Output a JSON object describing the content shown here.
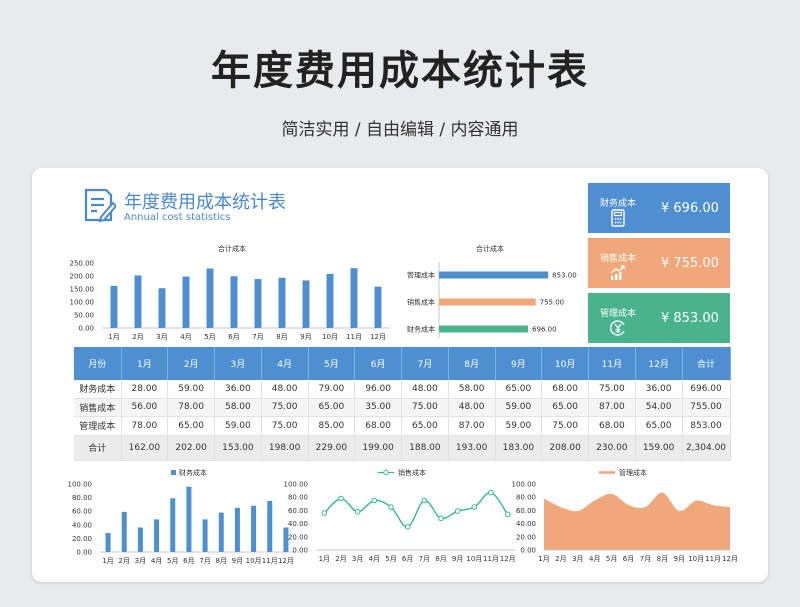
{
  "header": {
    "title": "年度费用成本统计表",
    "subtitle": "简洁实用 / 自由编辑 / 内容通用"
  },
  "card": {
    "title": "年度费用成本统计表",
    "subtitle": "Annual cost statistics"
  },
  "stats": [
    {
      "name": "财务成本",
      "value": "¥ 696.00",
      "color": "#4e8fd1",
      "icon": "calculator-icon"
    },
    {
      "name": "销售成本",
      "value": "¥ 755.00",
      "color": "#f0a779",
      "icon": "rising-chart-icon"
    },
    {
      "name": "管理成本",
      "value": "¥ 853.00",
      "color": "#49b48c",
      "icon": "yen-coin-icon"
    }
  ],
  "colors": {
    "blue": "#4e8fd1",
    "orange": "#f0a779",
    "green": "#49b48c",
    "line_green": "#3ab88e"
  },
  "table": {
    "headers": [
      "月份",
      "1月",
      "2月",
      "3月",
      "4月",
      "5月",
      "6月",
      "7月",
      "8月",
      "9月",
      "10月",
      "11月",
      "12月",
      "合计"
    ],
    "rows": [
      [
        "财务成本",
        "28.00",
        "59.00",
        "36.00",
        "48.00",
        "79.00",
        "96.00",
        "48.00",
        "58.00",
        "65.00",
        "68.00",
        "75.00",
        "36.00",
        "696.00"
      ],
      [
        "销售成本",
        "56.00",
        "78.00",
        "58.00",
        "75.00",
        "65.00",
        "35.00",
        "75.00",
        "48.00",
        "59.00",
        "65.00",
        "87.00",
        "54.00",
        "755.00"
      ],
      [
        "管理成本",
        "78.00",
        "65.00",
        "59.00",
        "75.00",
        "85.00",
        "68.00",
        "65.00",
        "87.00",
        "59.00",
        "75.00",
        "68.00",
        "65.00",
        "853.00"
      ],
      [
        "合计",
        "162.00",
        "202.00",
        "153.00",
        "198.00",
        "229.00",
        "199.00",
        "188.00",
        "193.00",
        "183.00",
        "208.00",
        "230.00",
        "159.00",
        "2,304.00"
      ]
    ]
  },
  "chart_data": [
    {
      "type": "bar",
      "title": "合计成本",
      "categories": [
        "1月",
        "2月",
        "3月",
        "4月",
        "5月",
        "6月",
        "7月",
        "8月",
        "9月",
        "10月",
        "11月",
        "12月"
      ],
      "values": [
        162,
        202,
        153,
        198,
        229,
        199,
        188,
        193,
        183,
        208,
        230,
        159
      ],
      "ylim": [
        0,
        250
      ],
      "yticks": [
        "0.00",
        "50.00",
        "100.00",
        "150.00",
        "200.00",
        "250.00"
      ],
      "grid": false
    },
    {
      "type": "bar",
      "orientation": "horizontal",
      "title": "合计成本",
      "categories": [
        "管理成本",
        "销售成本",
        "财务成本"
      ],
      "values": [
        853,
        755,
        696
      ],
      "labels": [
        "853.00",
        "755.00",
        "696.00"
      ],
      "colors": [
        "#4e8fd1",
        "#f0a779",
        "#49b48c"
      ]
    },
    {
      "type": "bar",
      "categories": [
        "1月",
        "2月",
        "3月",
        "4月",
        "5月",
        "6月",
        "7月",
        "8月",
        "9月",
        "10月",
        "11月",
        "12月"
      ],
      "series": [
        {
          "name": "财务成本",
          "values": [
            28,
            59,
            36,
            48,
            79,
            96,
            48,
            58,
            65,
            68,
            75,
            36
          ]
        }
      ],
      "ylim": [
        0,
        100
      ],
      "yticks": [
        "0.00",
        "20.00",
        "40.00",
        "60.00",
        "80.00",
        "100.00"
      ],
      "legend": "top-center"
    },
    {
      "type": "line",
      "categories": [
        "1月",
        "2月",
        "3月",
        "4月",
        "5月",
        "6月",
        "7月",
        "8月",
        "9月",
        "10月",
        "11月",
        "12月"
      ],
      "series": [
        {
          "name": "销售成本",
          "values": [
            56,
            78,
            58,
            75,
            65,
            35,
            75,
            48,
            59,
            65,
            87,
            54
          ]
        }
      ],
      "ylim": [
        0,
        100
      ],
      "yticks": [
        "0.00",
        "20.00",
        "40.00",
        "60.00",
        "80.00",
        "100.00"
      ],
      "legend": "top-center"
    },
    {
      "type": "area",
      "categories": [
        "1月",
        "2月",
        "3月",
        "4月",
        "5月",
        "6月",
        "7月",
        "8月",
        "9月",
        "10月",
        "11月",
        "12月"
      ],
      "series": [
        {
          "name": "管理成本",
          "values": [
            78,
            65,
            59,
            75,
            85,
            68,
            65,
            87,
            59,
            75,
            68,
            65
          ]
        }
      ],
      "ylim": [
        0,
        100
      ],
      "yticks": [
        "0.00",
        "20.00",
        "40.00",
        "60.00",
        "80.00",
        "100.00"
      ],
      "legend": "top-center"
    }
  ]
}
